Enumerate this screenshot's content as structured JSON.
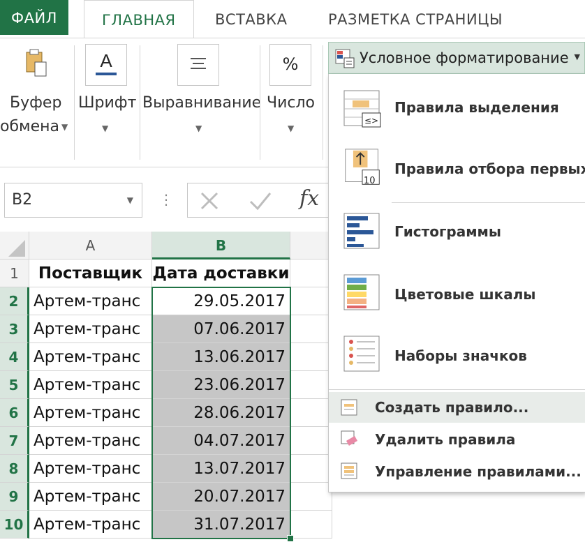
{
  "tabs": {
    "file": "ФАЙЛ",
    "home": "ГЛАВНАЯ",
    "insert": "ВСТАВКА",
    "layout": "РАЗМЕТКА СТРАНИЦЫ"
  },
  "ribbon": {
    "clipboard_l1": "Буфер",
    "clipboard_l2": "обмена",
    "font": "Шрифт",
    "alignment": "Выравнивание",
    "number": "Число",
    "number_icon": "%",
    "font_icon": "A",
    "conditional_formatting": "Условное форматирование"
  },
  "formula_bar": {
    "namebox": "B2",
    "fx": "fx"
  },
  "columns": [
    "A",
    "B"
  ],
  "rows": [
    "1",
    "2",
    "3",
    "4",
    "5",
    "6",
    "7",
    "8",
    "9",
    "10"
  ],
  "table": {
    "header_a": "Поставщик",
    "header_b": "Дата доставки",
    "supplier": "Артем-транс",
    "dates": [
      "29.05.2017",
      "07.06.2017",
      "13.06.2017",
      "23.06.2017",
      "28.06.2017",
      "04.07.2017",
      "13.07.2017",
      "20.07.2017",
      "31.07.2017"
    ]
  },
  "menu": {
    "highlight_rules": "Правила выделения",
    "top_rules": "Правила отбора первых",
    "data_bars": "Гистограммы",
    "color_scales": "Цветовые шкалы",
    "icon_sets": "Наборы значков",
    "new_rule": "Создать правило...",
    "clear_rules": "Удалить правила",
    "manage_rules": "Управление правилами...",
    "icon_number": "10"
  },
  "colors": {
    "excel_green": "#217346",
    "selection_fill": "#c6c6c6"
  }
}
